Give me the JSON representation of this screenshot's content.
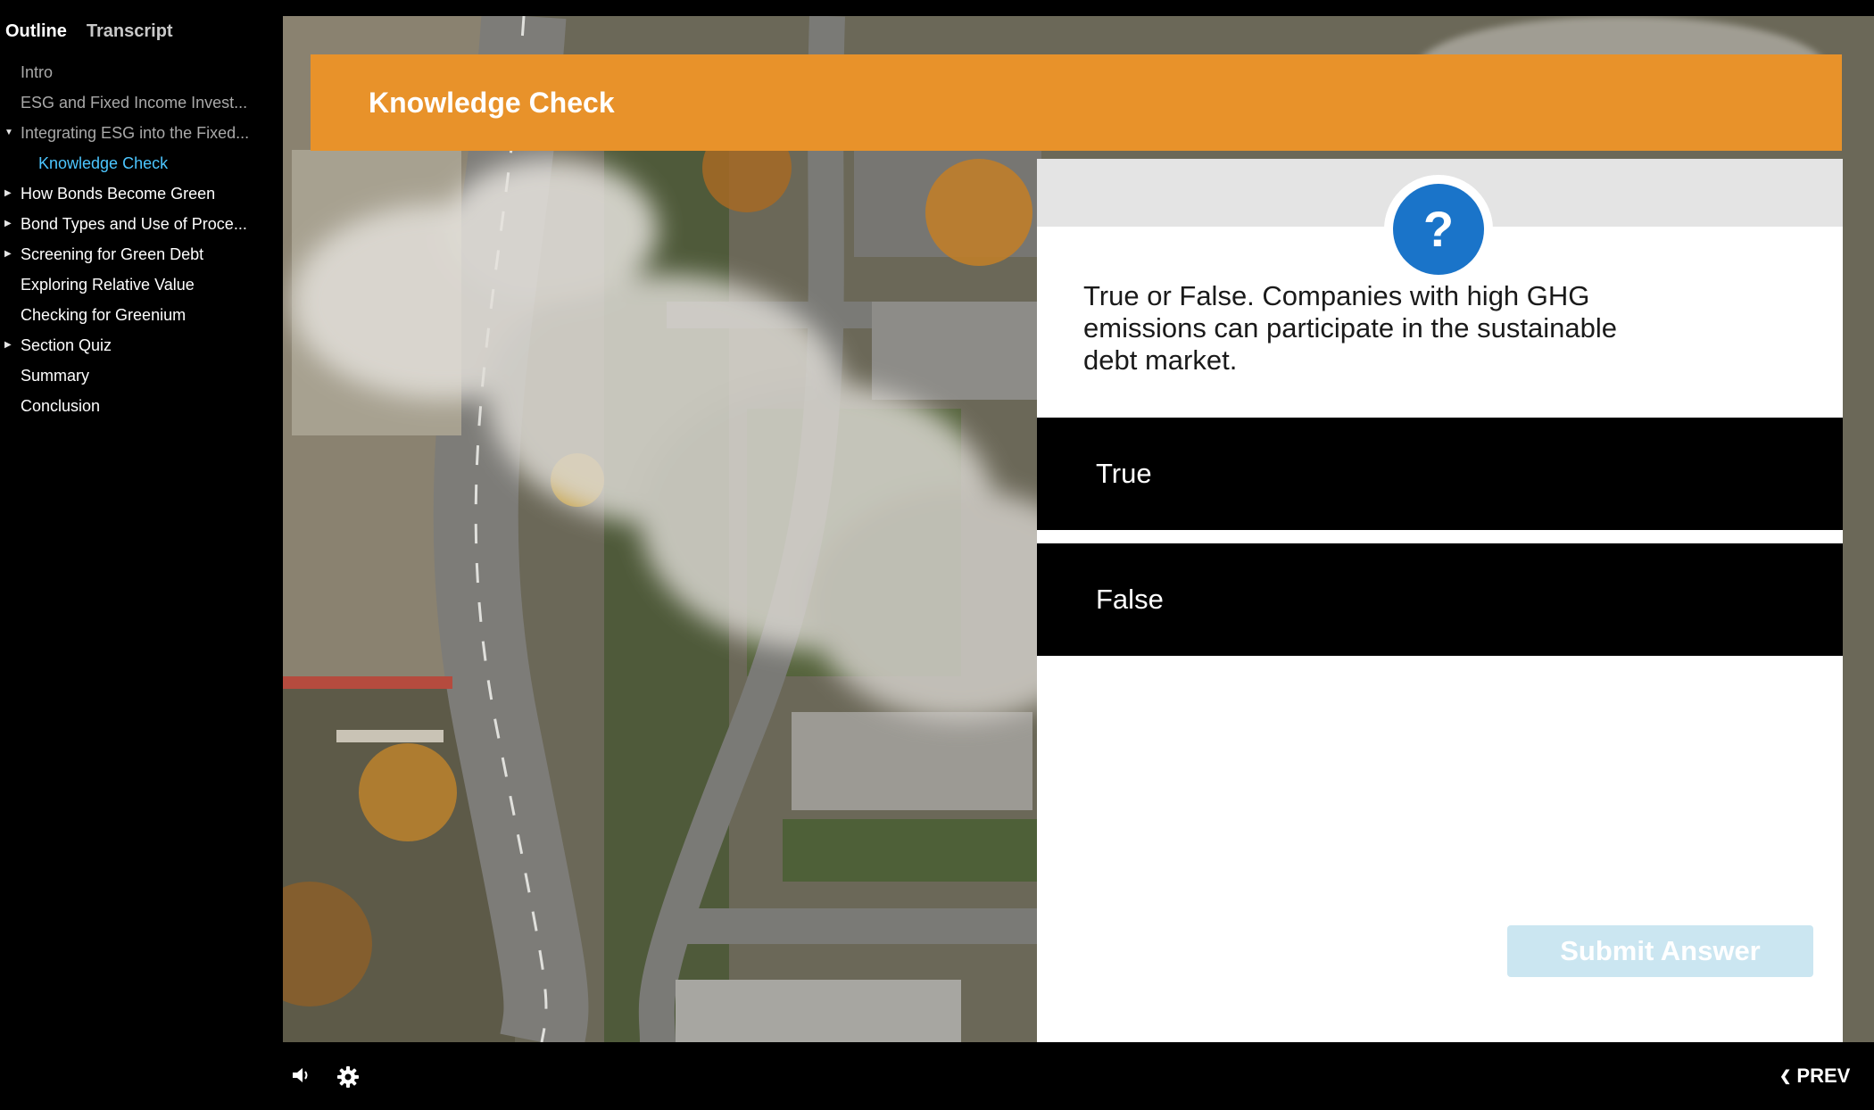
{
  "sidebar": {
    "tabs": [
      {
        "label": "Outline"
      },
      {
        "label": "Transcript"
      }
    ],
    "items": [
      {
        "label": "Intro"
      },
      {
        "label": "ESG and Fixed Income Invest..."
      },
      {
        "label": "Integrating ESG into the Fixed..."
      },
      {
        "label": "Knowledge Check"
      },
      {
        "label": "How Bonds Become Green"
      },
      {
        "label": "Bond Types and Use of Proce..."
      },
      {
        "label": "Screening for Green Debt"
      },
      {
        "label": "Exploring Relative Value"
      },
      {
        "label": "Checking for Greenium"
      },
      {
        "label": "Section Quiz"
      },
      {
        "label": "Summary"
      },
      {
        "label": "Conclusion"
      }
    ]
  },
  "slide": {
    "header_title": "Knowledge Check",
    "badge_symbol": "?",
    "question": "True or False. Companies with high GHG emissions can participate in the sustainable debt market.",
    "options": [
      {
        "label": "True"
      },
      {
        "label": "False"
      }
    ],
    "submit_label": "Submit Answer"
  },
  "player": {
    "prev_label": "PREV",
    "icons": [
      "volume-icon",
      "settings-icon",
      "chevron-left-icon",
      "question-icon"
    ]
  },
  "colors": {
    "header_orange": "#e8922a",
    "badge_blue": "#1a74c9",
    "current_item": "#4cc6ff",
    "submit_disabled": "#cbe6f1"
  }
}
